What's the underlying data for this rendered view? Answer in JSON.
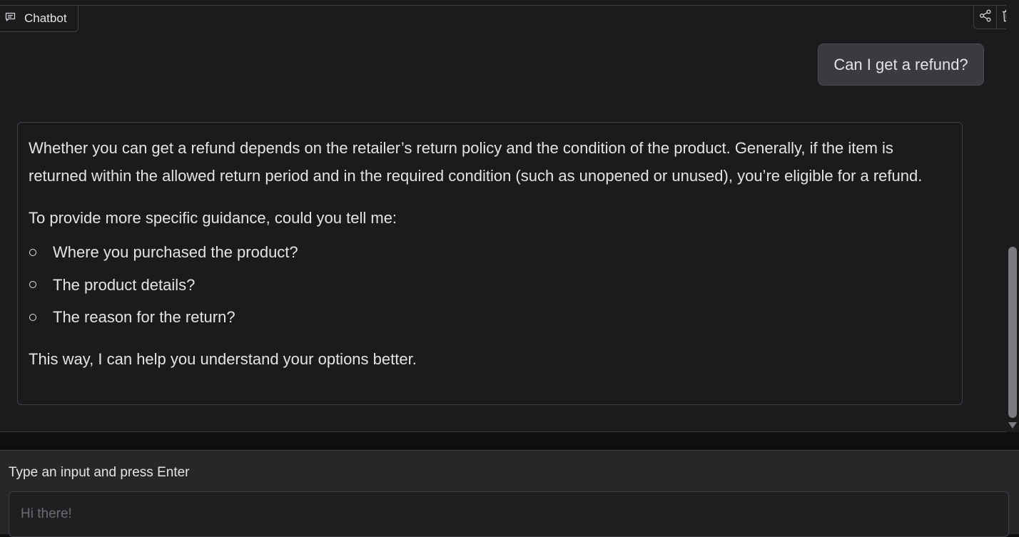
{
  "panel": {
    "label": "Chatbot"
  },
  "actions": {
    "share_icon": "share-icon",
    "delete_icon": "trash-icon"
  },
  "messages": {
    "user": "Can I get a refund?",
    "bot": {
      "intro": "Whether you can get a refund depends on the retailer’s return policy and the condition of the product. Generally, if the item is returned within the allowed return period and in the required condition (such as unopened or unused), you’re eligible for a refund.",
      "lead": "To provide more specific guidance, could you tell me:",
      "items": [
        "Where you purchased the product?",
        "The product details?",
        "The reason for the return?"
      ],
      "closing": "This way, I can help you understand your options better."
    }
  },
  "input": {
    "label": "Type an input and press Enter",
    "placeholder": "Hi there!",
    "value": ""
  },
  "colors": {
    "background": "#1b1b1d",
    "user_bubble": "#3a3a3f",
    "border": "#3f3f46",
    "input_panel": "#27272a"
  }
}
